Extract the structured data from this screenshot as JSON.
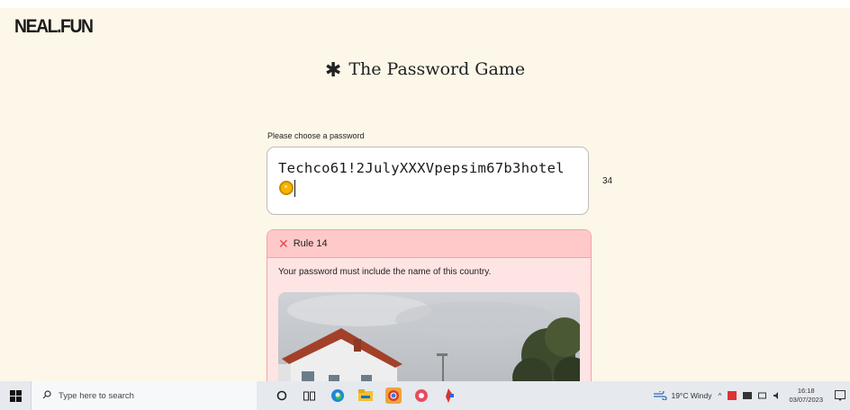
{
  "site": {
    "logo": "NEAL.FUN"
  },
  "game": {
    "title_icon": "asterisk-icon",
    "title": "The Password Game",
    "password_label": "Please choose a password",
    "password_value": "Techco61!2JulyXXXVpepsim67b3hotel",
    "password_emoji": "sun-emoji",
    "char_count": "34"
  },
  "rule": {
    "label": "Rule 14",
    "text": "Your password must include the name of this country.",
    "status_color": "#e24a4a"
  },
  "taskbar": {
    "search_placeholder": "Type here to search",
    "apps": [
      "cortana-icon",
      "task-view-icon",
      "edge-icon",
      "file-explorer-icon",
      "chrome-icon",
      "app-icon",
      "app-icon-2"
    ],
    "weather": "19°C Windy",
    "time": "16:18",
    "date": "03/07/2023"
  },
  "colors": {
    "background": "#fcf7e8",
    "rule_bg": "#ffe4e4",
    "rule_header": "#ffc9c9"
  }
}
